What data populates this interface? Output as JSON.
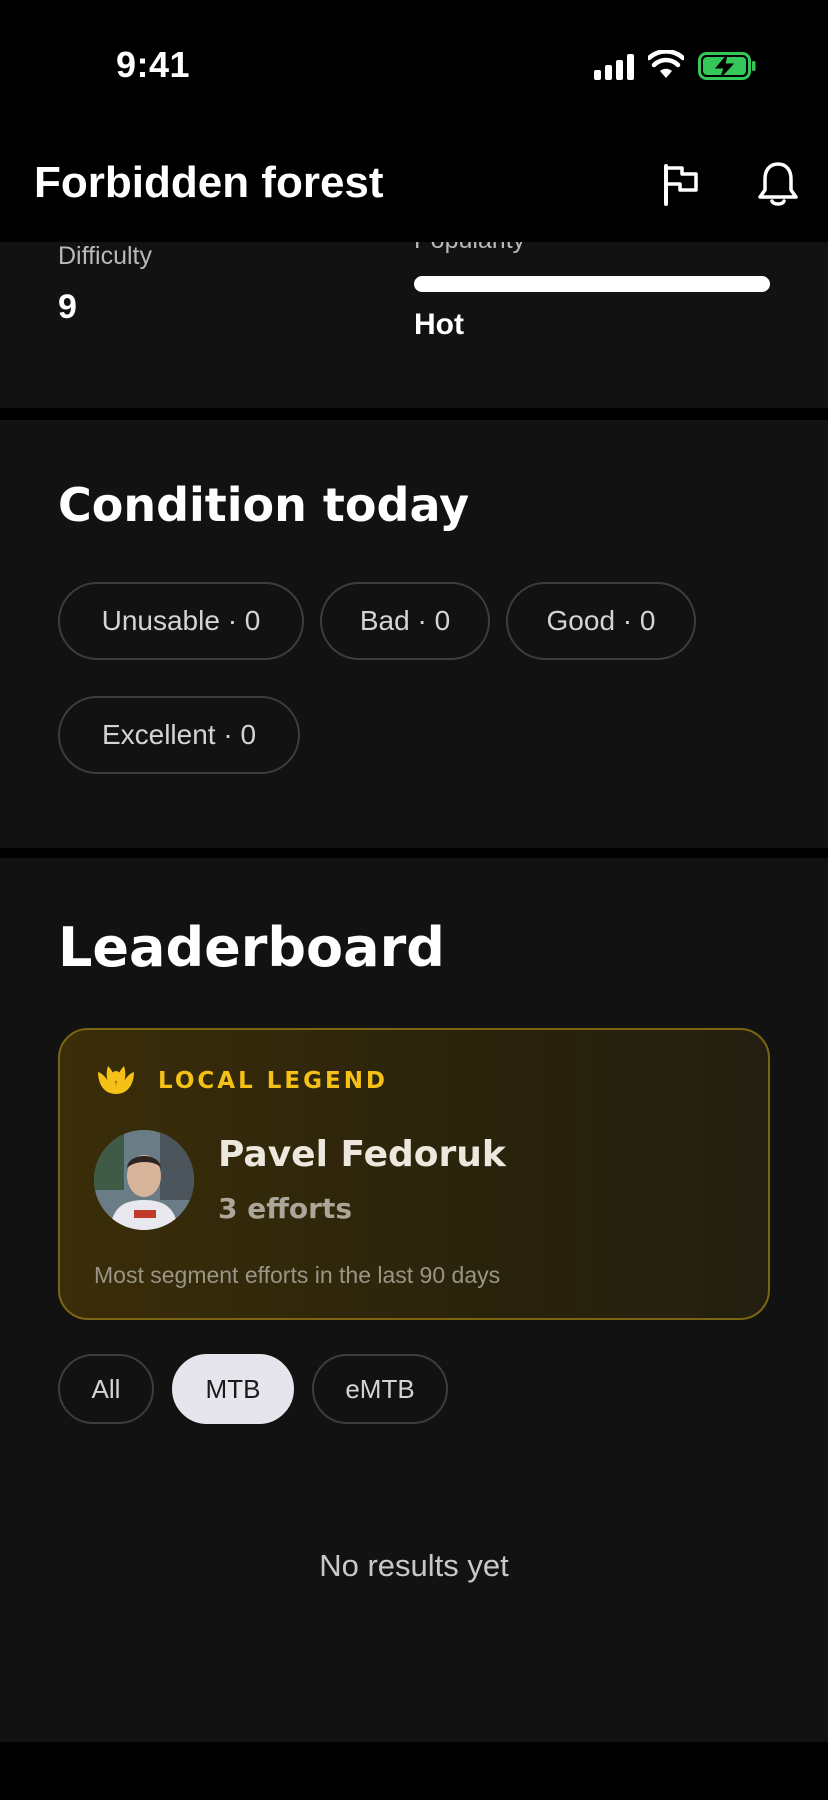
{
  "status_bar": {
    "time": "9:41"
  },
  "header": {
    "title": "Forbidden forest",
    "icons": [
      "flag-icon",
      "bell-icon"
    ]
  },
  "stats": {
    "difficulty_label": "Difficulty",
    "difficulty_value": "9",
    "popularity_label": "Popularity",
    "popularity_value": "Hot"
  },
  "condition": {
    "title": "Condition today",
    "chips": [
      {
        "label": "Unusable · 0"
      },
      {
        "label": "Bad · 0"
      },
      {
        "label": "Good · 0"
      },
      {
        "label": "Excellent · 0"
      }
    ]
  },
  "leaderboard": {
    "title": "Leaderboard",
    "legend": {
      "label": "LOCAL LEGEND",
      "name": "Pavel Fedoruk",
      "efforts": "3 efforts",
      "description": "Most segment efforts in the last 90 days"
    },
    "filters": [
      {
        "label": "All",
        "active": false
      },
      {
        "label": "MTB",
        "active": true
      },
      {
        "label": "eMTB",
        "active": false
      }
    ],
    "empty_text": "No results yet"
  },
  "colors": {
    "accent": "#f5c117",
    "background": "#121212",
    "battery": "#34c759"
  }
}
